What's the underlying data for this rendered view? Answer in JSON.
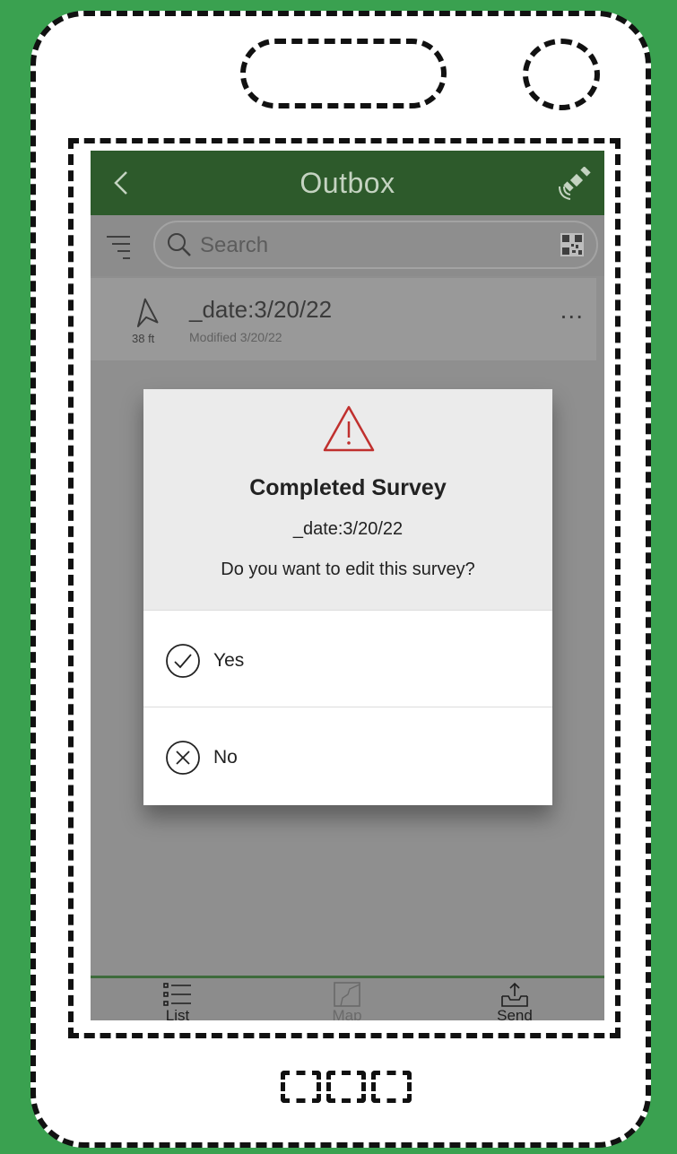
{
  "topbar": {
    "title": "Outbox",
    "back_icon": "chevron-left-icon",
    "gps_icon": "satellite-icon"
  },
  "search": {
    "placeholder": "Search",
    "filter_icon": "filter-icon",
    "qr_icon": "qr-code-icon"
  },
  "list_item": {
    "title": "_date:3/20/22",
    "subtitle": "Modified 3/20/22",
    "distance": "38 ft",
    "icon": "navigation-arrow-icon",
    "more_label": "..."
  },
  "dialog": {
    "icon": "warning-icon",
    "title": "Completed Survey",
    "subtitle": "_date:3/20/22",
    "question": "Do you want to edit this survey?",
    "options": [
      {
        "label": "Yes",
        "icon": "check-circle-icon"
      },
      {
        "label": "No",
        "icon": "x-circle-icon"
      }
    ]
  },
  "tabs": [
    {
      "label": "List",
      "icon": "list-icon"
    },
    {
      "label": "Map",
      "icon": "map-icon"
    },
    {
      "label": "Send",
      "icon": "send-icon"
    }
  ],
  "colors": {
    "background": "#3aa150",
    "header": "#2d5a2b",
    "warning": "#c0302e"
  }
}
